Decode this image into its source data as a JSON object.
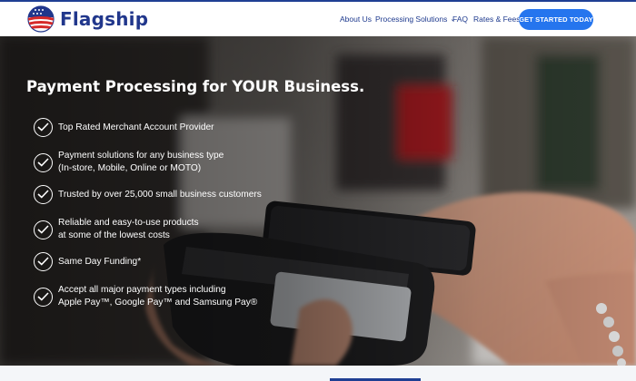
{
  "brand": {
    "name": "Flagship",
    "logo_icon": "flag-globe-icon",
    "colors": {
      "navy": "#21378c",
      "accent": "#2575ee",
      "red": "#d62a2a"
    }
  },
  "nav": {
    "items": [
      {
        "label": "About Us"
      },
      {
        "label": "Processing Solutions",
        "has_dropdown": true,
        "icon": "chevron-down-icon"
      },
      {
        "label": "FAQ"
      },
      {
        "label": "Rates & Fees"
      }
    ],
    "cta_label": "GET STARTED TODAY"
  },
  "hero": {
    "title": "Payment Processing for YOUR Business.",
    "features": [
      {
        "lines": [
          "Top Rated Merchant Account Provider"
        ],
        "icon": "check-circle-icon"
      },
      {
        "lines": [
          "Payment solutions for any business type",
          "(In-store, Mobile, Online or MOTO)"
        ],
        "icon": "check-circle-icon"
      },
      {
        "lines": [
          "Trusted by over 25,000 small business customers"
        ],
        "icon": "check-circle-icon"
      },
      {
        "lines": [
          "Reliable and easy-to-use products",
          "at some of the lowest costs"
        ],
        "icon": "check-circle-icon"
      },
      {
        "lines": [
          "Same Day Funding*"
        ],
        "icon": "check-circle-icon"
      },
      {
        "lines": [
          "Accept all major payment types including",
          "Apple Pay™, Google Pay™ and Samsung Pay®"
        ],
        "icon": "check-circle-icon"
      }
    ]
  }
}
